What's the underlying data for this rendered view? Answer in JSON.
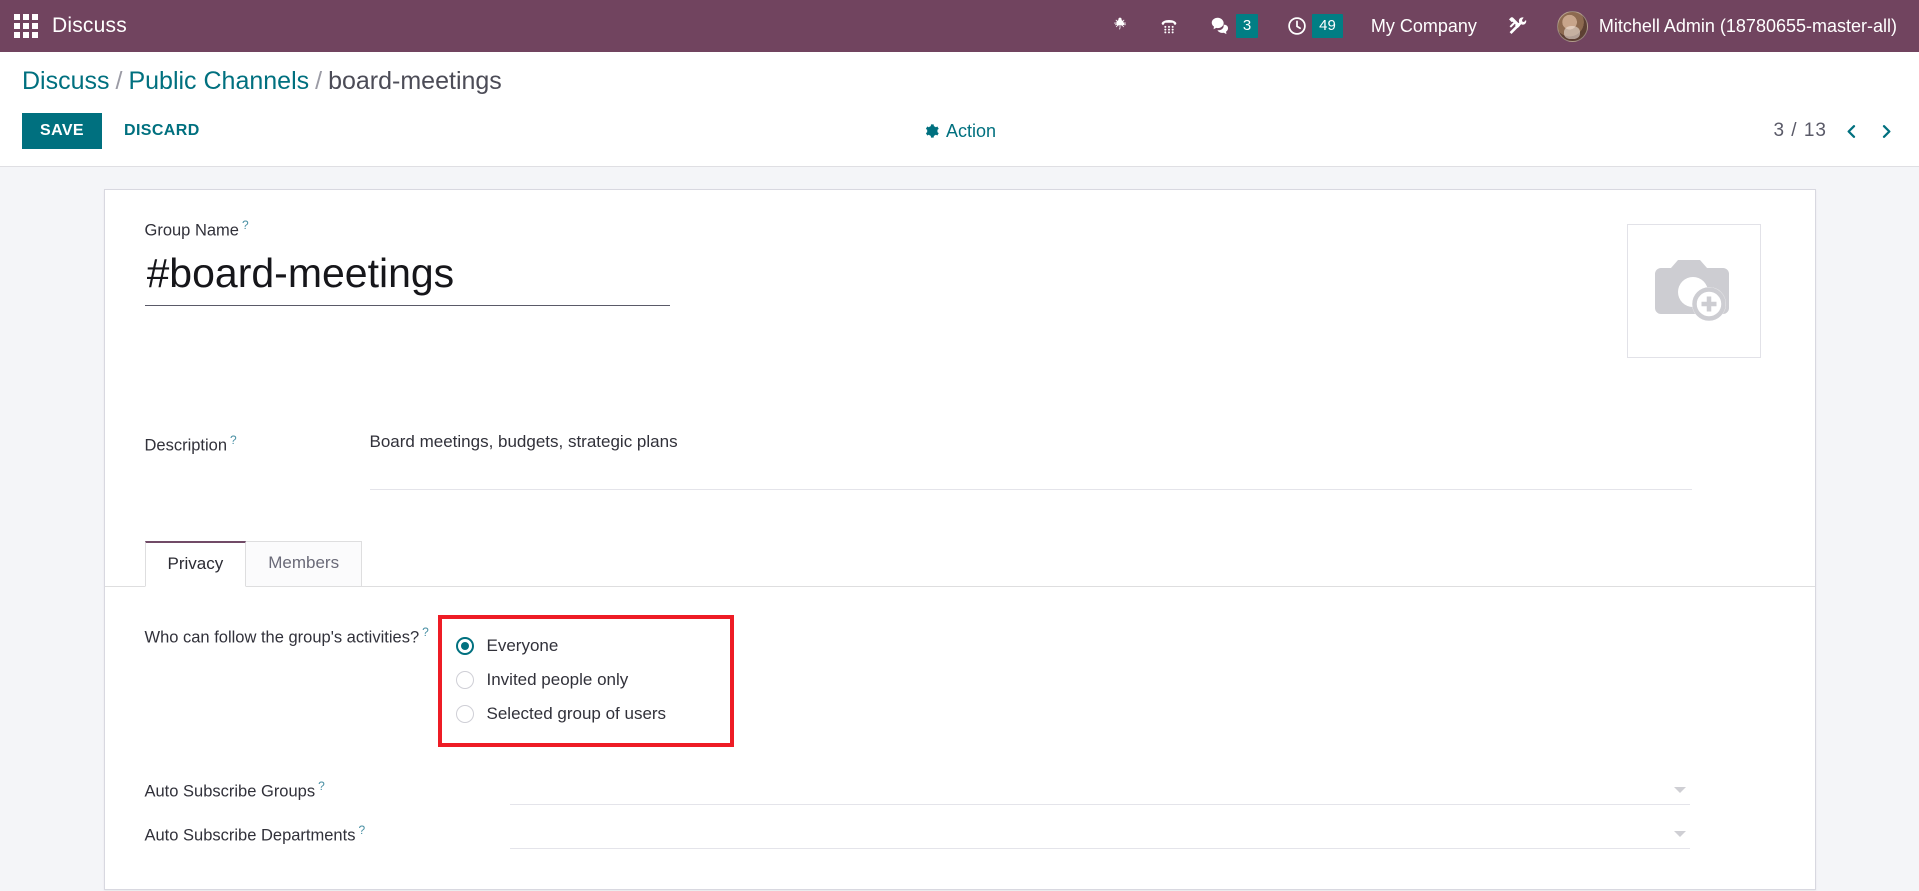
{
  "navbar": {
    "apps_icon": "apps-grid-icon",
    "app_title": "Discuss",
    "icons": [
      {
        "name": "bug-icon",
        "label": "Bug"
      },
      {
        "name": "phone-dialpad-icon",
        "label": "Phone"
      }
    ],
    "messages": {
      "icon": "chat-bubble-icon",
      "count": "3"
    },
    "activities": {
      "icon": "clock-icon",
      "count": "49"
    },
    "company": "My Company",
    "tools_icon": "wrench-screwdriver-icon",
    "user": "Mitchell Admin (18780655-master-all)",
    "bg_color": "#71445f"
  },
  "breadcrumb": {
    "root": "Discuss",
    "parent": "Public Channels",
    "current": "board-meetings",
    "separator": "/"
  },
  "control_panel": {
    "save_label": "SAVE",
    "discard_label": "DISCARD",
    "action_label": "Action",
    "action_icon": "gear-icon",
    "pager_value": "3 / 13",
    "pager_prev_icon": "chevron-left-icon",
    "pager_next_icon": "chevron-right-icon",
    "accent_color": "#00707f"
  },
  "form": {
    "group_name": {
      "label": "Group Name",
      "tip": "?",
      "value": "#board-meetings",
      "placeholder": "e.g. group-name"
    },
    "image": {
      "name": "channel-image-placeholder",
      "icon": "camera-add-icon"
    },
    "description": {
      "label": "Description",
      "tip": "?",
      "value": "Board meetings, budgets, strategic plans",
      "placeholder": ""
    },
    "tabs": [
      {
        "label": "Privacy",
        "active": true
      },
      {
        "label": "Members",
        "active": false
      }
    ],
    "privacy": {
      "question_label": "Who can follow the group's activities?",
      "tip": "?",
      "highlight_color": "#ee1c25",
      "options": [
        {
          "label": "Everyone",
          "checked": true
        },
        {
          "label": "Invited people only",
          "checked": false
        },
        {
          "label": "Selected group of users",
          "checked": false
        }
      ]
    },
    "auto_subscribe_groups": {
      "label": "Auto Subscribe Groups",
      "tip": "?",
      "value": "",
      "placeholder": ""
    },
    "auto_subscribe_departments": {
      "label": "Auto Subscribe Departments",
      "tip": "?",
      "value": "",
      "placeholder": ""
    }
  }
}
